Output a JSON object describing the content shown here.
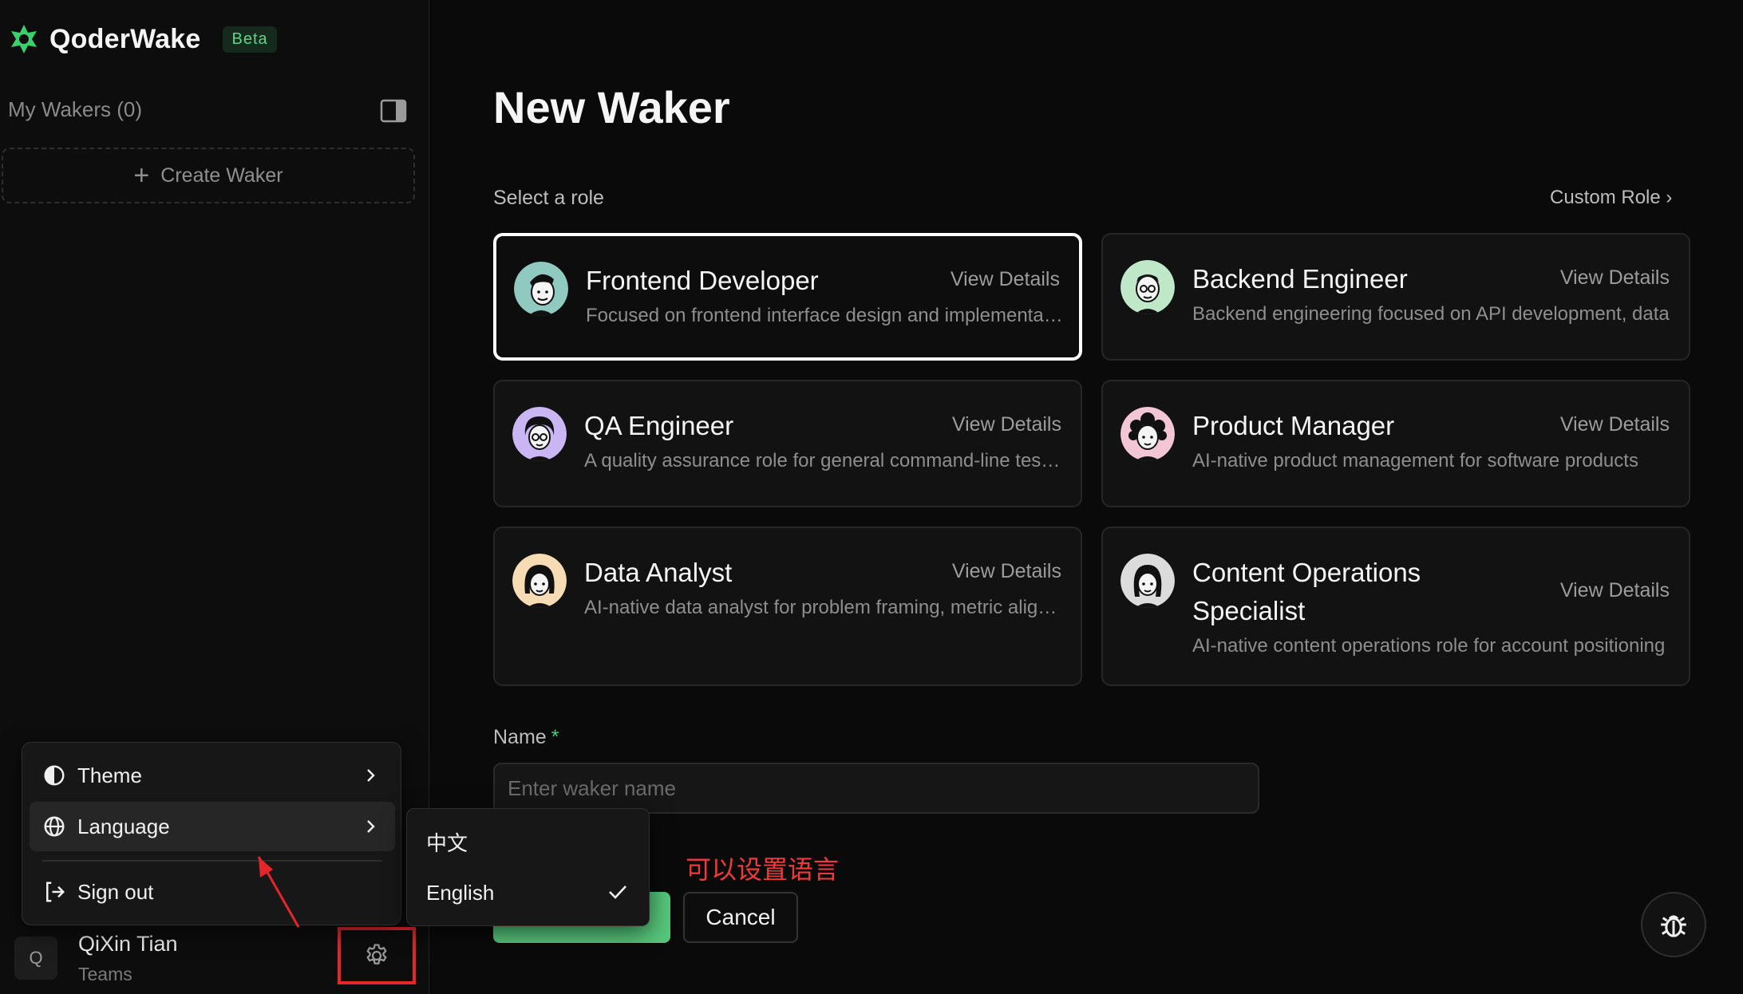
{
  "brand": {
    "name": "QoderWake",
    "badge": "Beta",
    "logo_color": "#3ccf6e"
  },
  "sidebar": {
    "my_wakers_label": "My Wakers (0)",
    "create_label": "Create Waker"
  },
  "user": {
    "initial": "Q",
    "name": "QiXin Tian",
    "team": "Teams"
  },
  "menu": {
    "theme_label": "Theme",
    "language_label": "Language",
    "signout_label": "Sign out"
  },
  "language_menu": {
    "options": [
      "中文",
      "English"
    ],
    "selected": "English"
  },
  "annotation": {
    "text": "可以设置语言",
    "color": "#e4262b"
  },
  "main": {
    "title": "New Waker",
    "select_role_label": "Select a role",
    "custom_role_label": "Custom Role ›",
    "view_details_label": "View Details",
    "roles": [
      {
        "name": "Frontend Developer",
        "desc": "Focused on frontend interface design and implementation",
        "selected": true
      },
      {
        "name": "Backend Engineer",
        "desc": "Backend engineering focused on API development, data",
        "selected": false
      },
      {
        "name": "QA Engineer",
        "desc": "A quality assurance role for general command-line testing",
        "selected": false
      },
      {
        "name": "Product Manager",
        "desc": "AI-native product management for software products",
        "selected": false
      },
      {
        "name": "Data Analyst",
        "desc": "AI-native data analyst for problem framing, metric alignment",
        "selected": false
      },
      {
        "name": "Content Operations Specialist",
        "desc": "AI-native content operations role for account positioning",
        "selected": false
      }
    ],
    "name_label": "Name",
    "name_required_mark": "*",
    "name_placeholder": "Enter waker name",
    "cancel_label": "Cancel"
  },
  "colors": {
    "accent_green": "#56c77b",
    "selected_border": "#ffffff",
    "background": "#0a0a0a"
  }
}
